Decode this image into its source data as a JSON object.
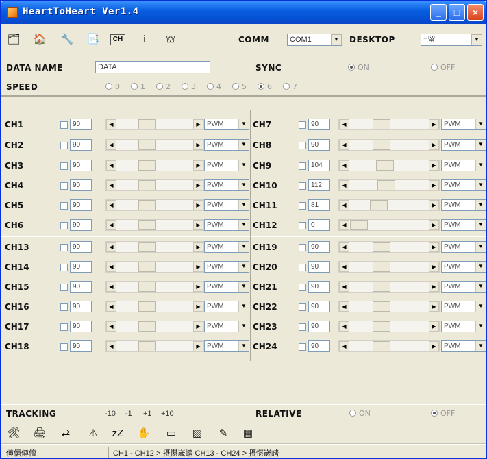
{
  "window": {
    "title": "HeartToHeart Ver1.4",
    "controls": [
      "_",
      "□",
      "×"
    ]
  },
  "toolbar": {
    "icons": [
      "open-icon",
      "save-icon",
      "wrench-icon",
      "import-icon",
      "channel-icon",
      "info-icon",
      "robot-icon"
    ],
    "icon_glyphs": [
      "🗂",
      "🏠",
      "🔧",
      "📑",
      "CH",
      "i",
      "⛫"
    ],
    "comm_label": "COMM",
    "comm_value": "COM1",
    "desktop_label": "DESKTOP",
    "desktop_value": "=留"
  },
  "data_name": {
    "label": "DATA NAME",
    "value": "DATA"
  },
  "sync": {
    "label": "SYNC",
    "on": "ON",
    "off": "OFF",
    "selected": "ON"
  },
  "speed": {
    "label": "SPEED",
    "options": [
      "0",
      "1",
      "2",
      "3",
      "4",
      "5",
      "6",
      "7"
    ],
    "selected": "6"
  },
  "channels": [
    {
      "name": "CH1",
      "value": "90",
      "level": 0.37,
      "mode": "PWM"
    },
    {
      "name": "CH2",
      "value": "90",
      "level": 0.37,
      "mode": "PWM"
    },
    {
      "name": "CH3",
      "value": "90",
      "level": 0.37,
      "mode": "PWM"
    },
    {
      "name": "CH4",
      "value": "90",
      "level": 0.37,
      "mode": "PWM"
    },
    {
      "name": "CH5",
      "value": "90",
      "level": 0.37,
      "mode": "PWM"
    },
    {
      "name": "CH6",
      "value": "90",
      "level": 0.37,
      "mode": "PWM"
    },
    {
      "name": "CH7",
      "value": "90",
      "level": 0.37,
      "mode": "PWM"
    },
    {
      "name": "CH8",
      "value": "90",
      "level": 0.37,
      "mode": "PWM"
    },
    {
      "name": "CH9",
      "value": "104",
      "level": 0.43,
      "mode": "PWM"
    },
    {
      "name": "CH10",
      "value": "112",
      "level": 0.46,
      "mode": "PWM"
    },
    {
      "name": "CH11",
      "value": "81",
      "level": 0.33,
      "mode": "PWM"
    },
    {
      "name": "CH12",
      "value": "0",
      "level": 0.0,
      "mode": "PWM"
    },
    {
      "name": "CH13",
      "value": "90",
      "level": 0.37,
      "mode": "PWM"
    },
    {
      "name": "CH14",
      "value": "90",
      "level": 0.37,
      "mode": "PWM"
    },
    {
      "name": "CH15",
      "value": "90",
      "level": 0.37,
      "mode": "PWM"
    },
    {
      "name": "CH16",
      "value": "90",
      "level": 0.37,
      "mode": "PWM"
    },
    {
      "name": "CH17",
      "value": "90",
      "level": 0.37,
      "mode": "PWM"
    },
    {
      "name": "CH18",
      "value": "90",
      "level": 0.37,
      "mode": "PWM"
    },
    {
      "name": "CH19",
      "value": "90",
      "level": 0.37,
      "mode": "PWM"
    },
    {
      "name": "CH20",
      "value": "90",
      "level": 0.37,
      "mode": "PWM"
    },
    {
      "name": "CH21",
      "value": "90",
      "level": 0.37,
      "mode": "PWM"
    },
    {
      "name": "CH22",
      "value": "90",
      "level": 0.37,
      "mode": "PWM"
    },
    {
      "name": "CH23",
      "value": "90",
      "level": 0.37,
      "mode": "PWM"
    },
    {
      "name": "CH24",
      "value": "90",
      "level": 0.37,
      "mode": "PWM"
    }
  ],
  "tracking": {
    "label": "TRACKING",
    "buttons": [
      "-10",
      "-1",
      "+1",
      "+10"
    ]
  },
  "relative": {
    "label": "RELATIVE",
    "on": "ON",
    "off": "OFF",
    "selected": "OFF"
  },
  "bottom_toolbar": {
    "icons": [
      "tools-icon",
      "transfer-icon",
      "network-icon",
      "warning-icon",
      "sleep-icon",
      "hand-icon",
      "window-icon",
      "image-icon",
      "edit-icon",
      "grid-icon"
    ],
    "icon_glyphs": [
      "🛠",
      "🖨",
      "⇄",
      "⚠",
      "zZ",
      "✋",
      "▭",
      "▨",
      "✎",
      "▦"
    ]
  },
  "status": {
    "left": "僙僒僔儃",
    "middle": "CH1 - CH12 > 摂愖嵗崉 CH13 - CH24 > 摂愖嵗崉"
  }
}
